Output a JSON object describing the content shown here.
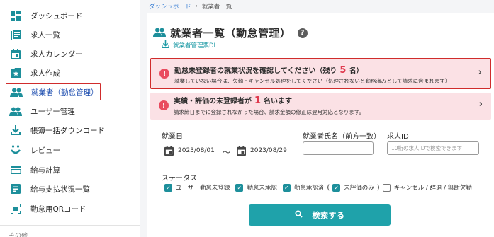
{
  "sidebar": {
    "items": [
      {
        "label": "ダッシュボード",
        "icon": "dashboard-icon"
      },
      {
        "label": "求人一覧",
        "icon": "job-list-icon"
      },
      {
        "label": "求人カレンダー",
        "icon": "calendar-icon"
      },
      {
        "label": "求人作成",
        "icon": "job-create-icon"
      },
      {
        "label": "就業者（勤怠管理）",
        "icon": "workers-icon"
      },
      {
        "label": "ユーザー管理",
        "icon": "users-icon"
      },
      {
        "label": "帳簿一括ダウンロード",
        "icon": "download-icon"
      },
      {
        "label": "レビュー",
        "icon": "review-icon"
      },
      {
        "label": "給与計算",
        "icon": "card-icon"
      },
      {
        "label": "給与支払状況一覧",
        "icon": "list-icon"
      },
      {
        "label": "勤怠用QRコード",
        "icon": "qr-icon"
      }
    ],
    "section_label": "その他"
  },
  "breadcrumb": {
    "home": "ダッシュボード",
    "sep": "›",
    "current": "就業者一覧"
  },
  "page": {
    "title": "就業者一覧（勤怠管理）",
    "help": "?",
    "download_label": "就業者管理票DL"
  },
  "alerts": [
    {
      "title_pre": "勤怠未登録者の就業状況を確認してください（残り",
      "count": "5",
      "title_post": "名）",
      "detail": "就業していない場合は、欠勤・キャンセル処理をしてください（処理されないと勤務済みとして請求に含まれます）",
      "chevron": "›"
    },
    {
      "title_pre": "実績・評価の未登録者が",
      "count": "1",
      "title_post": "名います",
      "detail": "請求締日までに登録されなかった場合、請求金額の修正は翌月対応となります。",
      "chevron": "›"
    }
  ],
  "form": {
    "work_date_label": "就業日",
    "date_from": "2023/08/01",
    "date_tilde": "〜",
    "date_to": "2023/08/29",
    "name_label": "就業者氏名（前方一致）",
    "name_value": "",
    "job_id_label": "求人ID",
    "job_id_placeholder": "10桁の求人IDで検索できます",
    "status_label": "ステータス",
    "statuses": [
      {
        "label": "ユーザー勤怠未登録",
        "checked": true
      },
      {
        "label": "勤怠未承認",
        "checked": true
      },
      {
        "label": "勤怠承認済",
        "checked": true
      },
      {
        "label": "未評価のみ",
        "checked": true
      },
      {
        "label": "キャンセル / 辞退 / 無断欠勤",
        "checked": false
      }
    ],
    "paren_open": "(",
    "paren_close": ")",
    "search_label": "検索する"
  },
  "colors": {
    "accent": "#1fa2aa",
    "alert_bg": "#fbe1e5",
    "alert_icon": "#e94b5f",
    "highlight_border": "#d02c2c"
  }
}
